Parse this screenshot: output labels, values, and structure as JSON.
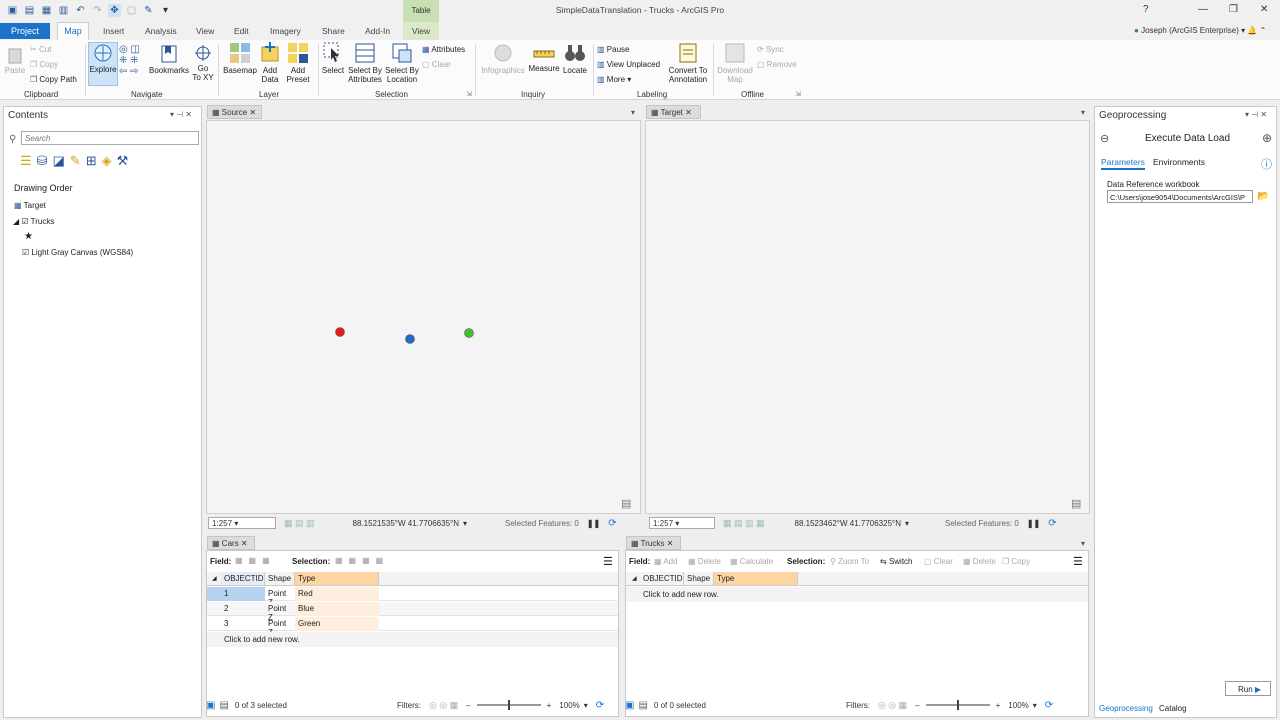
{
  "titlebar": {
    "title": "SimpleDataTranslation - Trucks - ArcGIS Pro",
    "context_tab": "Table",
    "help": "?",
    "min": "—",
    "restore": "❐",
    "close": "✕"
  },
  "tabs": {
    "project": "Project",
    "map": "Map",
    "insert": "Insert",
    "analysis": "Analysis",
    "view": "View",
    "edit": "Edit",
    "imagery": "Imagery",
    "share": "Share",
    "addin": "Add-In",
    "ctx_view": "View"
  },
  "user": "Joseph (ArcGIS Enterprise) ▾",
  "ribbon": {
    "clipboard": {
      "paste": "Paste",
      "cut": "Cut",
      "copy": "Copy",
      "copy_path": "Copy Path",
      "group": "Clipboard"
    },
    "navigate": {
      "explore": "Explore",
      "bookmarks": "Bookmarks",
      "goto": "Go\nTo XY",
      "group": "Navigate"
    },
    "layer": {
      "basemap": "Basemap",
      "add_data": "Add\nData",
      "add_preset": "Add\nPreset",
      "group": "Layer"
    },
    "selection": {
      "select": "Select",
      "by_attr": "Select By\nAttributes",
      "by_loc": "Select By\nLocation",
      "attributes": "Attributes",
      "clear": "Clear",
      "group": "Selection"
    },
    "inquiry": {
      "infographics": "Infographics",
      "measure": "Measure",
      "locate": "Locate",
      "group": "Inquiry"
    },
    "labeling": {
      "pause": "Pause",
      "view_unplaced": "View Unplaced",
      "more": "More ▾",
      "convert": "Convert To\nAnnotation",
      "group": "Labeling"
    },
    "offline": {
      "download": "Download\nMap",
      "sync": "Sync",
      "remove": "Remove",
      "group": "Offline"
    }
  },
  "contents": {
    "title": "Contents",
    "search_placeholder": "Search",
    "drawing_order": "Drawing Order",
    "target": "Target",
    "trucks": "Trucks",
    "basemap": "Light Gray Canvas (WGS84)"
  },
  "source_map": {
    "tab": "Source",
    "scale": "1:257",
    "coords": "88.1521535°W 41.7706635°N",
    "selected": "Selected Features: 0"
  },
  "target_map": {
    "tab": "Target",
    "scale": "1:257",
    "coords": "88.1523462°W 41.7706325°N",
    "selected": "Selected Features: 0"
  },
  "cars_table": {
    "tab": "Cars",
    "field_label": "Field:",
    "selection_label": "Selection:",
    "columns": [
      "OBJECTID",
      "Shape",
      "Type"
    ],
    "rows": [
      [
        "1",
        "Point Z",
        "Red"
      ],
      [
        "2",
        "Point Z",
        "Blue"
      ],
      [
        "3",
        "Point Z",
        "Green"
      ]
    ],
    "add_row": "Click to add new row.",
    "status": "0 of 3 selected",
    "filters": "Filters:",
    "zoom": "100%"
  },
  "trucks_table": {
    "tab": "Trucks",
    "field_label": "Field:",
    "add": "Add",
    "delete": "Delete",
    "calculate": "Calculate",
    "selection_label": "Selection:",
    "zoom_to": "Zoom To",
    "switch": "Switch",
    "clear": "Clear",
    "delete2": "Delete",
    "copy": "Copy",
    "columns": [
      "OBJECTID",
      "Shape",
      "Type"
    ],
    "add_row": "Click to add new row.",
    "status": "0 of 0 selected",
    "filters": "Filters:",
    "zoom": "100%"
  },
  "geoprocessing": {
    "title": "Geoprocessing",
    "tool": "Execute Data Load",
    "tab_params": "Parameters",
    "tab_env": "Environments",
    "param_label": "Data Reference workbook",
    "param_value": "C:\\Users\\jose9054\\Documents\\ArcGIS\\P",
    "run": "Run",
    "bottom_tab1": "Geoprocessing",
    "bottom_tab2": "Catalog"
  },
  "colors": {
    "accent": "#1a73c8",
    "red": "#e21b1b",
    "blue": "#2268cf",
    "green": "#3ec32a",
    "type_col": "#fcd5a2"
  }
}
